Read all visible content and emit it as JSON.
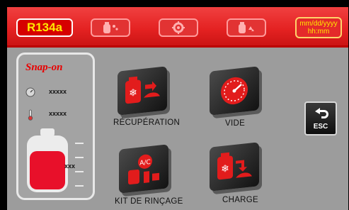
{
  "topbar": {
    "refrigerant": "R134a",
    "datetime_date": "mm/dd/yyyy",
    "datetime_time": "hh:mm"
  },
  "panel": {
    "brand": "Snap-on",
    "pressure_value": "xxxxx",
    "temperature_value": "xxxxx",
    "tank_value": "xxx"
  },
  "tiles": {
    "recovery": "RÉCUPÉRATION",
    "vacuum": "VIDE",
    "flush_kit": "KIT DE RINÇAGE",
    "charge": "CHARGE"
  },
  "esc_label": "ESC",
  "colors": {
    "topbar_red": "#e42222",
    "screen_gray": "#9c9c9c",
    "refrigerant_text": "#ffe800",
    "tank_red": "#e8102a"
  }
}
